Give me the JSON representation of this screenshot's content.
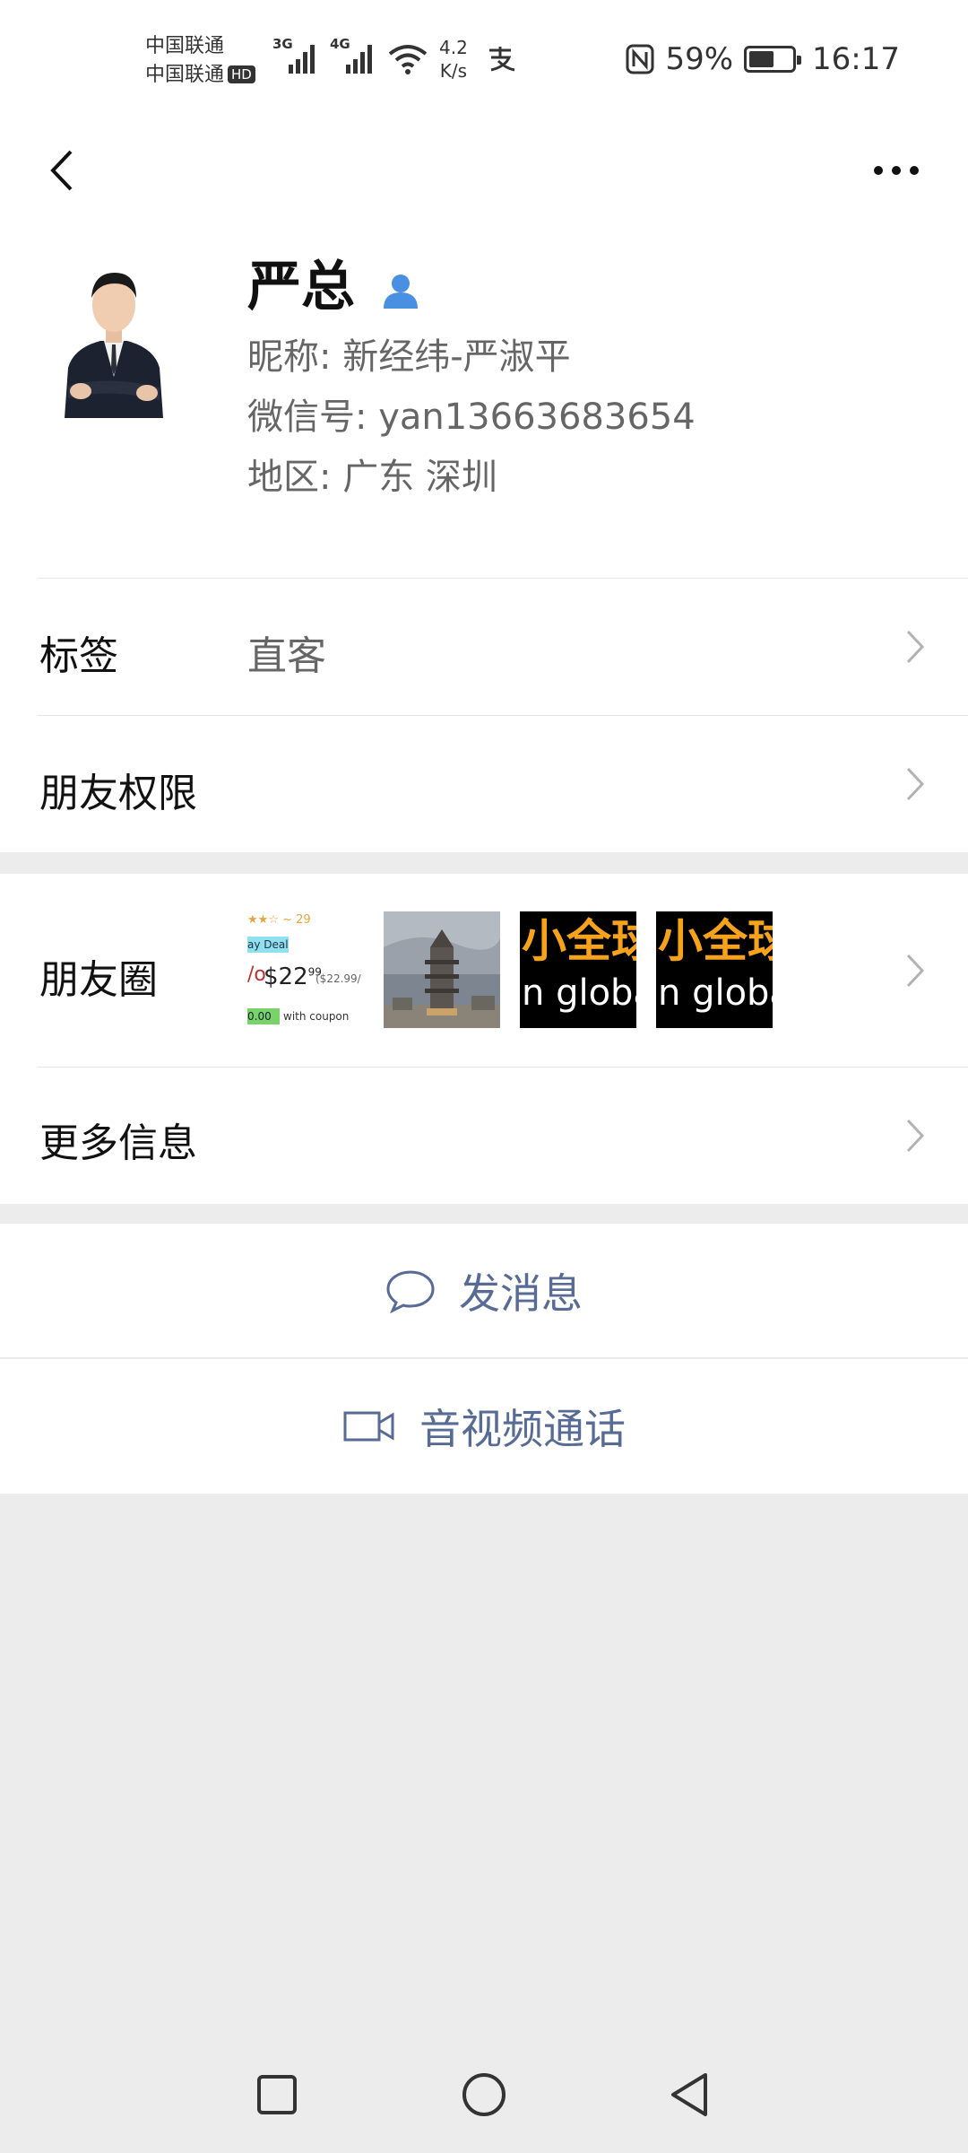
{
  "status_bar": {
    "carrier1": "中国联通",
    "carrier2": "中国联通",
    "hd_badge": "HD",
    "signal1_label": "3G",
    "signal2_label": "4G",
    "net_speed_value": "4.2",
    "net_speed_unit": "K/s",
    "battery_percent": "59%",
    "battery_level": 0.59,
    "time": "16:17"
  },
  "profile": {
    "name": "严总",
    "nickname": "昵称:  新经纬-严淑平",
    "wechat_id": "微信号:  yan13663683654",
    "region": "地区:  广东  深圳"
  },
  "rows": {
    "tags_label": "标签",
    "tags_value": "直客",
    "permissions_label": "朋友权限",
    "moments_label": "朋友圈",
    "more_info_label": "更多信息"
  },
  "moments_thumbs": {
    "t1_stars": "★★☆ ~ 29",
    "t1_deal": "ay Deal",
    "t1_pct": "/o",
    "t1_price": "$22",
    "t1_cents": "99",
    "t1_orig": "($22.99/",
    "t1_badge": "0.00",
    "t1_coupon": "with coupon",
    "t3_top": "小全球",
    "t3_bottom": "n globa",
    "t4_top": "小全球",
    "t4_bottom": "n globa"
  },
  "actions": {
    "send_message": "发消息",
    "video_call": "音视频通话"
  },
  "colors": {
    "link_blue": "#576b95",
    "page_bg": "#ececec",
    "person_icon": "#4a90e2"
  }
}
